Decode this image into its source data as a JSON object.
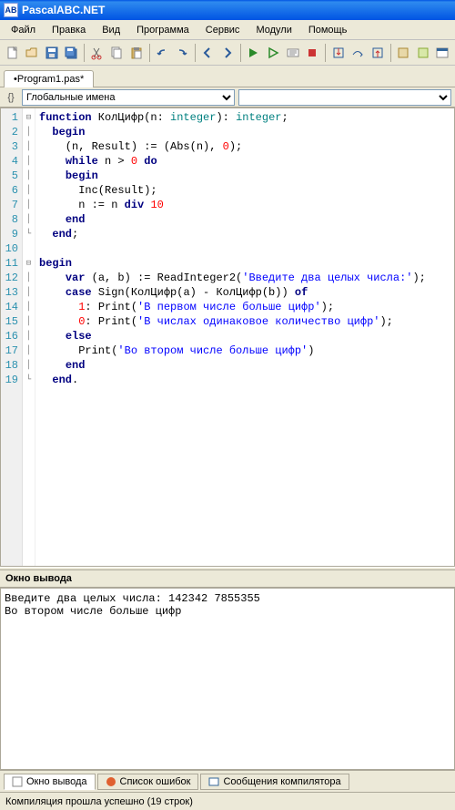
{
  "window": {
    "title": "PascalABC.NET"
  },
  "menu": {
    "file": "Файл",
    "edit": "Правка",
    "view": "Вид",
    "program": "Программа",
    "service": "Сервис",
    "modules": "Модули",
    "help": "Помощь"
  },
  "tab": {
    "name": "•Program1.pas*"
  },
  "scope": {
    "label": "Глобальные имена"
  },
  "code": {
    "lines": [
      "1",
      "2",
      "3",
      "4",
      "5",
      "6",
      "7",
      "8",
      "9",
      "10",
      "11",
      "12",
      "13",
      "14",
      "15",
      "16",
      "17",
      "18",
      "19"
    ],
    "l1_fn": "function",
    "l1_name": " КолЦифр(n: ",
    "l1_int": "integer",
    "l1_paren": "): ",
    "l1_int2": "integer",
    "l1_end": ";",
    "l2": "begin",
    "l3a": "    (n, Result) := (Abs(n), ",
    "l3b": "0",
    "l3c": ");",
    "l4a": "    ",
    "l4_while": "while",
    "l4b": " n > ",
    "l4c": "0",
    "l4d": " ",
    "l4_do": "do",
    "l5a": "    ",
    "l5": "begin",
    "l6": "      Inc(Result);",
    "l7a": "      n := n ",
    "l7_div": "div",
    "l7b": " ",
    "l7c": "10",
    "l8a": "    ",
    "l8": "end",
    "l9a": "  ",
    "l9": "end",
    "l9b": ";",
    "l10": "",
    "l11": "begin",
    "l12a": "    ",
    "l12_var": "var",
    "l12b": " (a, b) := ReadInteger2(",
    "l12c": "'Введите два целых числа:'",
    "l12d": ");",
    "l13a": "    ",
    "l13_case": "case",
    "l13b": " Sign(КолЦифр(a) - КолЦифр(b)) ",
    "l13_of": "of",
    "l14a": "      ",
    "l14b": "1",
    "l14c": ": Print(",
    "l14d": "'В первом числе больше цифр'",
    "l14e": ");",
    "l15a": "      ",
    "l15b": "0",
    "l15c": ": Print(",
    "l15d": "'В числах одинаковое количество цифр'",
    "l15e": ");",
    "l16a": "    ",
    "l16_else": "else",
    "l17a": "      Print(",
    "l17b": "'Во втором числе больше цифр'",
    "l17c": ")",
    "l18a": "    ",
    "l18": "end",
    "l19a": "  ",
    "l19": "end",
    "l19b": "."
  },
  "output": {
    "title": "Окно вывода",
    "text": "Введите два целых числа: 142342 7855355\nВо втором числе больше цифр"
  },
  "bottom_tabs": {
    "t1": "Окно вывода",
    "t2": "Список ошибок",
    "t3": "Сообщения компилятора"
  },
  "status": "Компиляция прошла успешно (19 строк)"
}
